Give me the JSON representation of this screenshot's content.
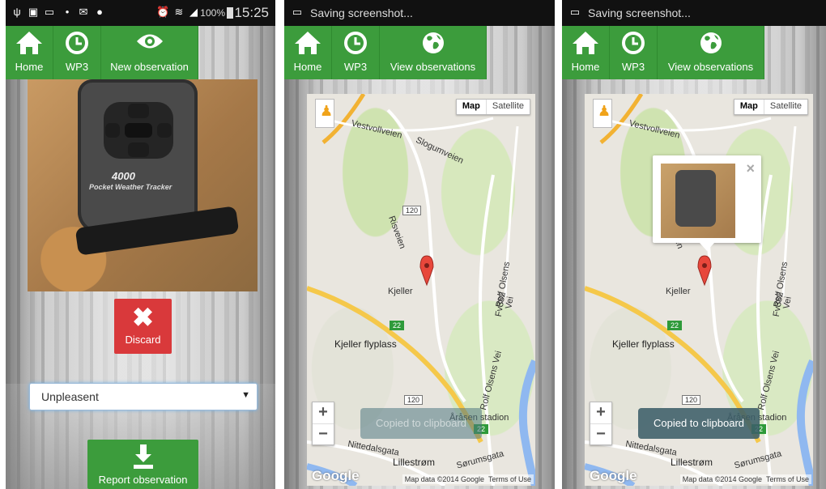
{
  "panel1": {
    "status": {
      "time": "15:25",
      "battery": "100%"
    },
    "nav": {
      "home": "Home",
      "wp3": "WP3",
      "action": "New observation"
    },
    "photo": {
      "device_model": "4000",
      "device_name": "Pocket Weather Tracker"
    },
    "discard_label": "Discard",
    "mood_select": {
      "value": "Unpleasent"
    },
    "report_label": "Report observation"
  },
  "panel2": {
    "status": {
      "text": "Saving screenshot..."
    },
    "nav": {
      "home": "Home",
      "wp3": "WP3",
      "action": "View observations"
    },
    "map": {
      "type_buttons": [
        "Map",
        "Satellite"
      ],
      "labels": {
        "kjeller": "Kjeller",
        "flyplass": "Kjeller flyplass",
        "lillestrom": "Lillestrøm",
        "arasen": "Åråsen stadion",
        "vestvoll": "Vestvollveien",
        "slogum": "Slogumveien",
        "rolf": "Rolf Olsens Vei",
        "fv382": "Fv382",
        "nittedal": "Nittedalsgata",
        "sorum": "Sørumsgata",
        "risveien": "Risveien"
      },
      "shields": {
        "r120a": "120",
        "r120b": "120",
        "r22a": "22",
        "r22b": "22"
      },
      "zoom_in": "+",
      "zoom_out": "−",
      "attribution": "Map data ©2014 Google",
      "terms": "Terms of Use",
      "logo": "Google"
    },
    "toast": "Copied to clipboard"
  },
  "panel3": {
    "status": {
      "text": "Saving screenshot..."
    },
    "nav": {
      "home": "Home",
      "wp3": "WP3",
      "action": "View observations"
    },
    "map": {
      "type_buttons": [
        "Map",
        "Satellite"
      ],
      "labels": {
        "kjeller": "Kjeller",
        "flyplass": "Kjeller flyplass",
        "lillestrom": "Lillestrøm",
        "arasen": "Åråsen stadion",
        "vestvoll": "Vestvollveien",
        "slogum": "Slogumveien",
        "rolf": "Rolf Olsens Vei",
        "fv382": "Fv382",
        "nittedal": "Nittedalsgata",
        "sorum": "Sørumsgata",
        "risveien": "Risveien"
      },
      "shields": {
        "r120a": "120",
        "r120b": "120",
        "r22a": "22",
        "r22b": "22"
      },
      "zoom_in": "+",
      "zoom_out": "−",
      "attribution": "Map data ©2014 Google",
      "terms": "Terms of Use",
      "logo": "Google"
    },
    "infowindow": {
      "close": "×"
    },
    "toast": "Copied to clipboard"
  },
  "colors": {
    "nav_green": "#3c9c3c",
    "discard_red": "#d9393b",
    "statusbar": "#111111"
  }
}
